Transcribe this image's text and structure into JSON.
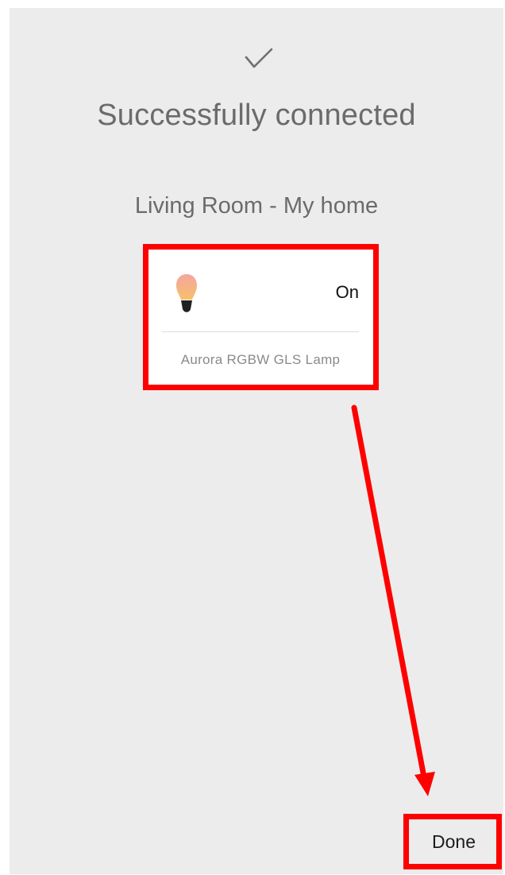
{
  "status": {
    "icon": "checkmark-icon",
    "title": "Successfully connected"
  },
  "room": {
    "label": "Living Room - My home"
  },
  "device": {
    "icon": "lightbulb-icon",
    "state": "On",
    "name": "Aurora RGBW GLS Lamp"
  },
  "footer": {
    "done_label": "Done"
  },
  "annotations": {
    "highlight_color": "#ff0000",
    "arrow_color": "#ff0000",
    "arrow_from": "device-card",
    "arrow_to": "done-button"
  },
  "colors": {
    "background": "#ececec",
    "card": "#ffffff",
    "text_muted": "#6b6b6b"
  }
}
